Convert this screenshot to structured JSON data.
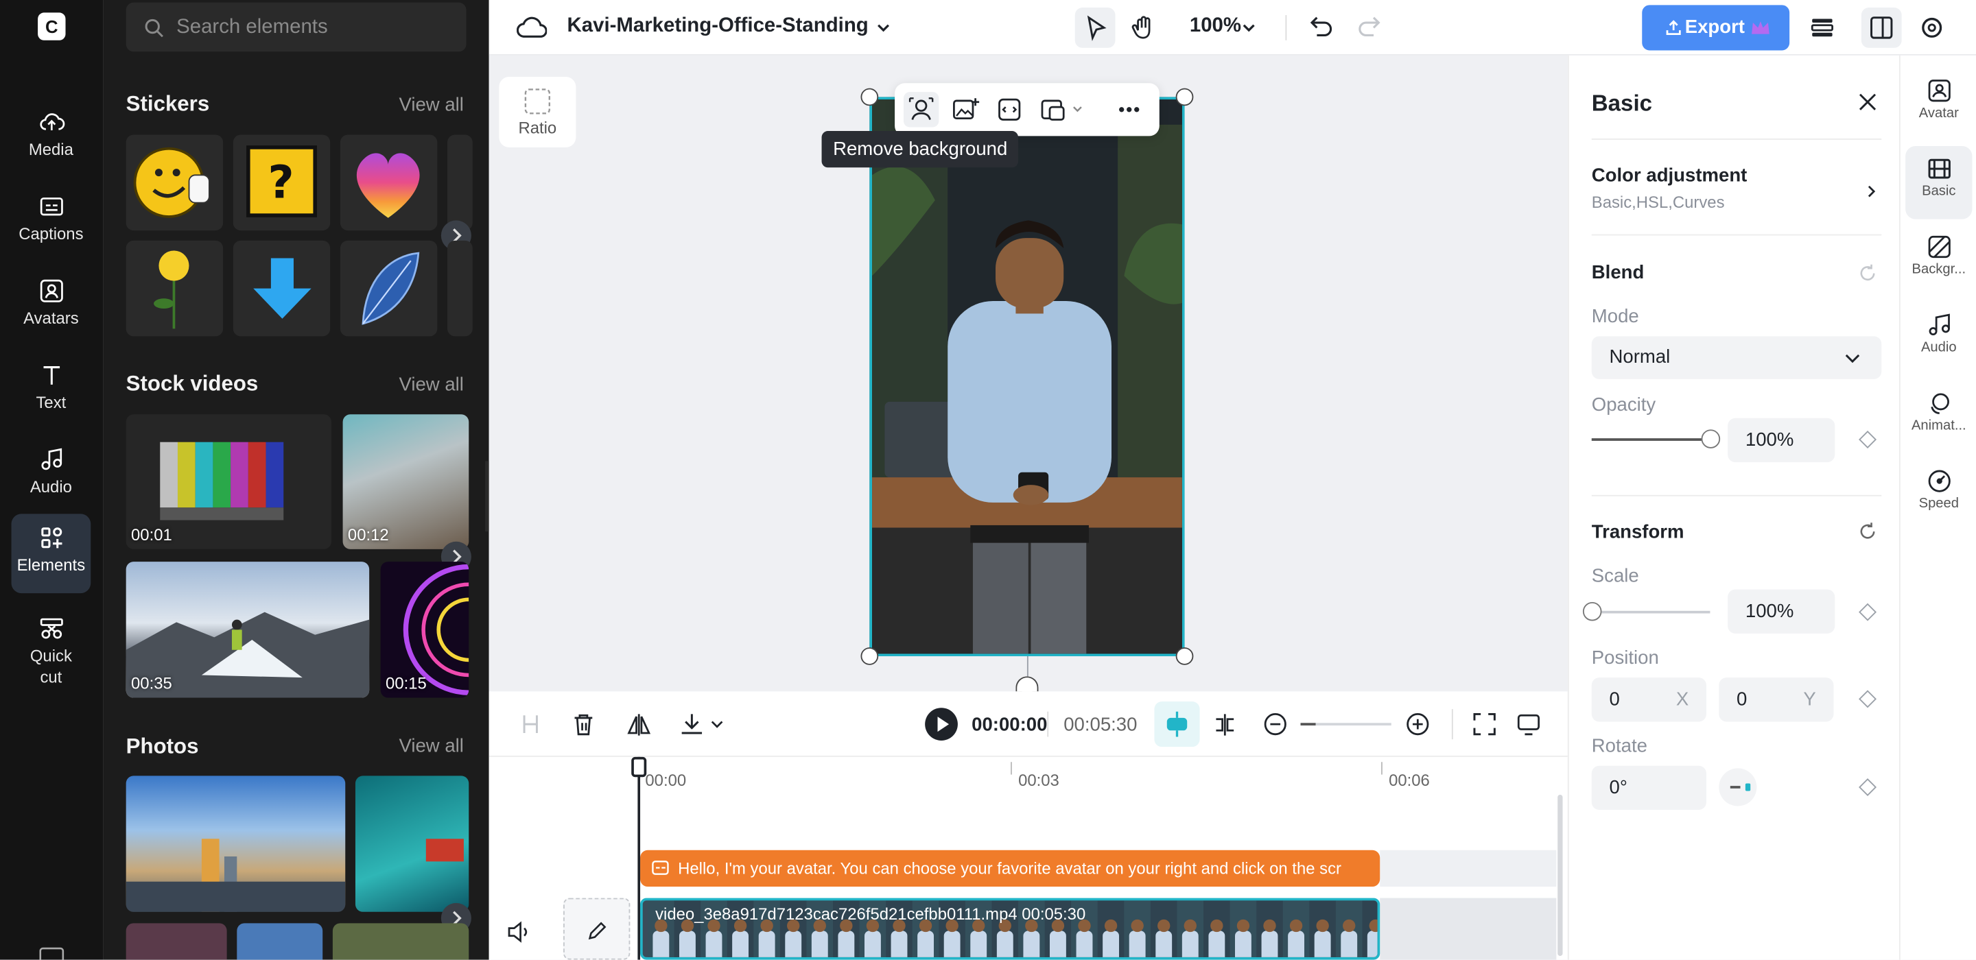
{
  "rail": {
    "logo": "C",
    "items": [
      {
        "label": "Media",
        "icon": "cloud-upload-icon"
      },
      {
        "label": "Captions",
        "icon": "captions-icon"
      },
      {
        "label": "Avatars",
        "icon": "avatar-icon"
      },
      {
        "label": "Text",
        "icon": "text-icon"
      },
      {
        "label": "Audio",
        "icon": "music-note-icon"
      },
      {
        "label": "Elements",
        "icon": "elements-icon",
        "active": true
      },
      {
        "label": "Quick cut",
        "icon": "scissors-icon"
      }
    ]
  },
  "panel": {
    "search_placeholder": "Search elements",
    "stickers": {
      "title": "Stickers",
      "view_all": "View all"
    },
    "stock_videos": {
      "title": "Stock videos",
      "view_all": "View all",
      "items": [
        {
          "duration": "00:01"
        },
        {
          "duration": "00:12"
        },
        {
          "duration": "00:35"
        },
        {
          "duration": "00:15"
        }
      ]
    },
    "photos": {
      "title": "Photos",
      "view_all": "View all"
    }
  },
  "topbar": {
    "project_title": "Kavi-Marketing-Office-Standing",
    "zoom": "100%",
    "export_label": "Export"
  },
  "canvas": {
    "ratio_label": "Ratio",
    "tooltip": "Remove background"
  },
  "timeline": {
    "current_time": "00:00:00",
    "total_time": "00:05:30",
    "ticks": [
      "00:00",
      "00:03",
      "00:06"
    ],
    "caption_text": "Hello, I'm your avatar. You can choose your favorite avatar on your right and click on the scr",
    "video_file": "video_3e8a917d7123cac726f5d21cefbb0111.mp4",
    "video_duration": "00:05:30"
  },
  "props": {
    "title": "Basic",
    "color_adjustment": {
      "title": "Color adjustment",
      "subtitle": "Basic,HSL,Curves"
    },
    "blend": {
      "title": "Blend",
      "mode_label": "Mode",
      "mode_value": "Normal",
      "opacity_label": "Opacity",
      "opacity_value": "100%",
      "opacity_level": 1.0
    },
    "transform": {
      "title": "Transform",
      "scale_label": "Scale",
      "scale_value": "100%",
      "scale_level": 0.0,
      "position_label": "Position",
      "pos_x": "0",
      "pos_x_unit": "X",
      "pos_y": "0",
      "pos_y_unit": "Y",
      "rotate_label": "Rotate",
      "rotate_value": "0°"
    }
  },
  "right_tabs": [
    {
      "label": "Avatar",
      "icon": "avatar-icon"
    },
    {
      "label": "Basic",
      "icon": "film-icon",
      "active": true
    },
    {
      "label": "Backgr...",
      "icon": "background-icon"
    },
    {
      "label": "Audio",
      "icon": "music-note-icon"
    },
    {
      "label": "Animat...",
      "icon": "animation-icon"
    },
    {
      "label": "Speed",
      "icon": "speed-icon"
    }
  ],
  "colors": {
    "accent": "#4a8cf5",
    "selection": "#22b5c8",
    "caption": "#f07c2a"
  }
}
